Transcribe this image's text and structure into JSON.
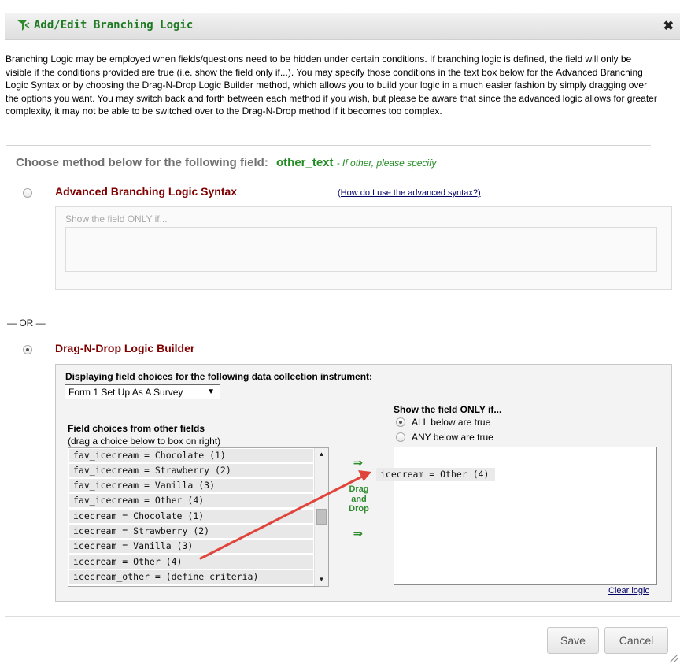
{
  "dialog": {
    "title": "Add/Edit Branching Logic",
    "close_symbol": "✖",
    "intro": "Branching Logic may be employed when fields/questions need to be hidden under certain conditions. If branching logic is defined, the field will only be visible if the conditions provided are true (i.e. show the field only if...). You may specify those conditions in the text box below for the Advanced Branching Logic Syntax or by choosing the Drag-N-Drop Logic Builder method, which allows you to build your logic in a much easier fashion by simply dragging over the options you want. You may switch back and forth between each method if you wish, but please be aware that since the advanced logic allows for greater complexity, it may not be able to be switched over to the Drag-N-Drop method if it becomes too complex."
  },
  "choose": {
    "prefix": "Choose method below for the following field:",
    "field_name": "other_text",
    "field_label": "- If other, please specify"
  },
  "advanced": {
    "label": "Advanced Branching Logic Syntax",
    "help_link": "(How do I use the advanced syntax?)",
    "placeholder": "Show the field ONLY if...",
    "value": "",
    "selected": false
  },
  "or_text": "— OR —",
  "dnd": {
    "label": "Drag-N-Drop Logic Builder",
    "selected": true,
    "instrument_prompt": "Displaying field choices for the following data collection instrument:",
    "instrument_selected": "Form 1 Set Up As A Survey",
    "choices_title": "Field choices from other fields",
    "choices_hint": "(drag a choice below to box on right)",
    "choices": [
      "fav_icecream = Chocolate (1)",
      "fav_icecream = Strawberry (2)",
      "fav_icecream = Vanilla (3)",
      "fav_icecream = Other (4)",
      "icecream = Chocolate (1)",
      "icecream = Strawberry (2)",
      "icecream = Vanilla (3)",
      "icecream = Other (4)",
      "icecream_other = (define criteria)"
    ],
    "arrow_glyph": "⇒",
    "drag_label_1": "Drag",
    "drag_label_2": "and",
    "drag_label_3": "Drop",
    "show_only_title": "Show the field ONLY if...",
    "option_all": "ALL below are true",
    "option_any": "ANY below are true",
    "all_selected": true,
    "dragged_item": "icecream = Other (4)",
    "clear_link": "Clear logic",
    "annotation_arrow_color": "#e0453c"
  },
  "footer": {
    "save_label": "Save",
    "cancel_label": "Cancel"
  }
}
